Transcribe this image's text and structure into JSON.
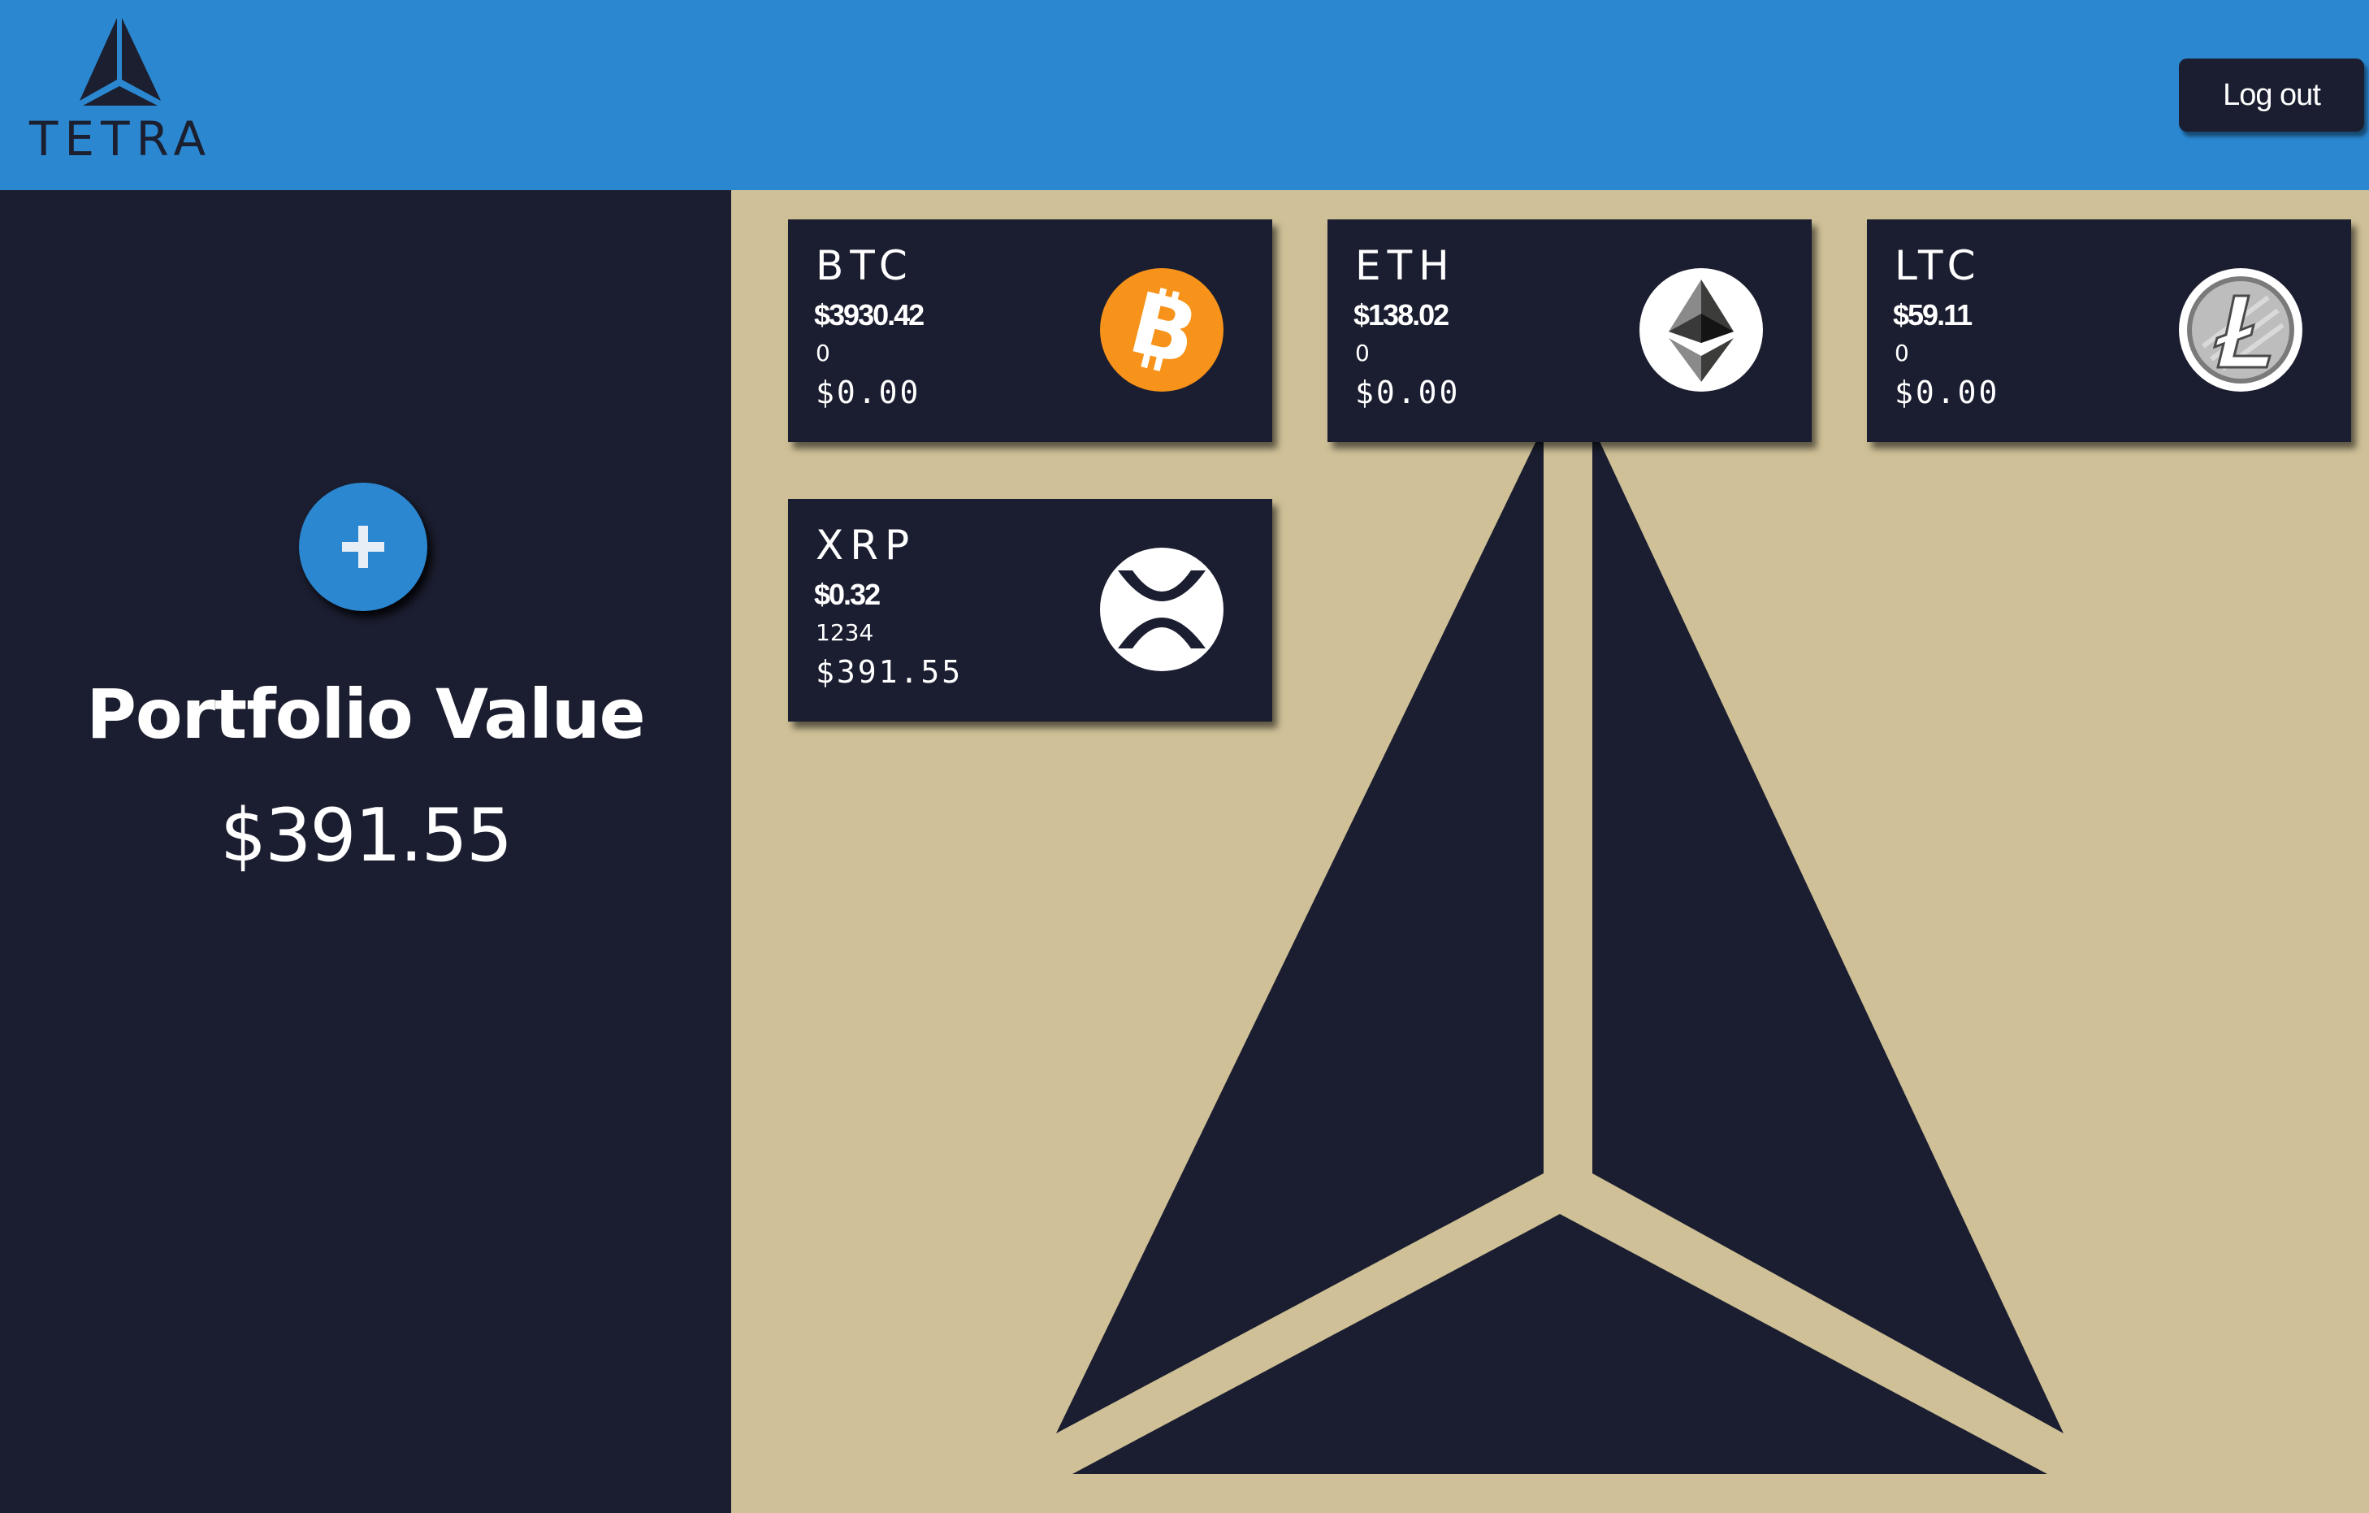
{
  "header": {
    "logo_text": "TETRA",
    "logout_label": "Log out",
    "colors": {
      "header_bg": "#2b87d0",
      "logout_bg": "#1b1e30"
    }
  },
  "sidebar": {
    "add_icon": "plus-icon",
    "title": "Portfolio Value",
    "value": "$391.55",
    "colors": {
      "bg": "#1b1e30",
      "add_button": "#2b87d0"
    }
  },
  "main": {
    "colors": {
      "bg": "#cfc097",
      "card_bg": "#1b1e30"
    },
    "cards": [
      {
        "symbol": "BTC",
        "price": "$3930.42",
        "quantity": "0",
        "holding": "$0.00",
        "icon": "bitcoin-icon",
        "color": "#f7931a"
      },
      {
        "symbol": "ETH",
        "price": "$138.02",
        "quantity": "0",
        "holding": "$0.00",
        "icon": "ethereum-icon",
        "color": "#ffffff"
      },
      {
        "symbol": "LTC",
        "price": "$59.11",
        "quantity": "0",
        "holding": "$0.00",
        "icon": "litecoin-icon",
        "color": "#ffffff"
      },
      {
        "symbol": "XRP",
        "price": "$0.32",
        "quantity": "1234",
        "holding": "$391.55",
        "icon": "xrp-icon",
        "color": "#ffffff"
      }
    ]
  }
}
